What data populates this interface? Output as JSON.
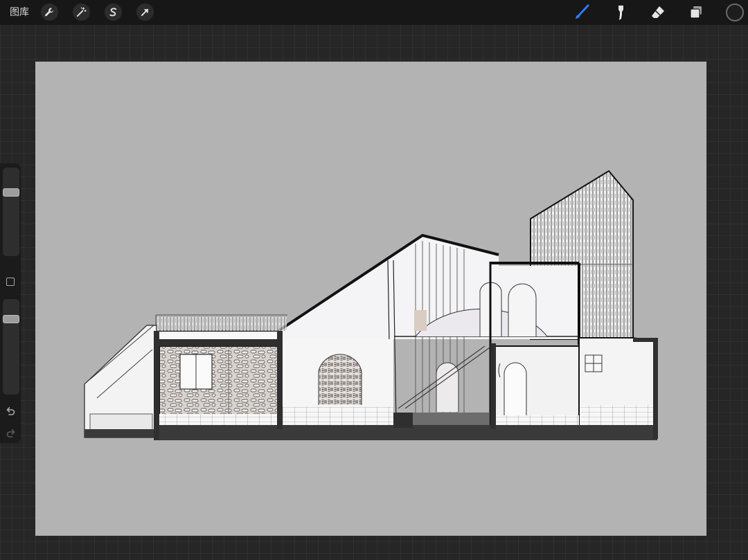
{
  "topbar": {
    "gallery_label": "图库",
    "left_tools": [
      "wrench-icon",
      "magic-wand-icon",
      "selection-icon",
      "transform-arrow-icon"
    ],
    "right_tools": [
      "brush-icon",
      "smudge-icon",
      "eraser-icon",
      "layers-icon"
    ],
    "active_tool": "brush-icon",
    "accent_color": "#2f7bf6",
    "current_color": "#1d1d1d"
  },
  "sidebar": {
    "brush_size": 0.74,
    "opacity": 0.82
  },
  "canvas": {
    "background": "#b3b3b3"
  }
}
